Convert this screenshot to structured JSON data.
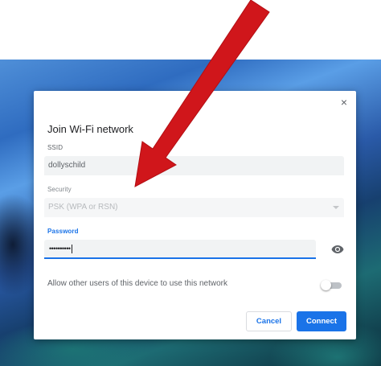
{
  "dialog": {
    "title": "Join Wi-Fi network",
    "close_glyph": "×",
    "ssid_label": "SSID",
    "ssid_value": "dollyschild",
    "security_label": "Security",
    "security_value": "PSK (WPA or RSN)",
    "password_label": "Password",
    "password_value": "••••••••••",
    "share_label": "Allow other users of this device to use this network",
    "share_enabled": false,
    "cancel_label": "Cancel",
    "connect_label": "Connect"
  },
  "icons": {
    "close": "close-icon",
    "show_password": "eye-icon",
    "dropdown": "chevron-down-icon",
    "annotation": "red-arrow-icon"
  },
  "colors": {
    "accent": "#1a73e8",
    "annotation_arrow": "#d0161b"
  }
}
